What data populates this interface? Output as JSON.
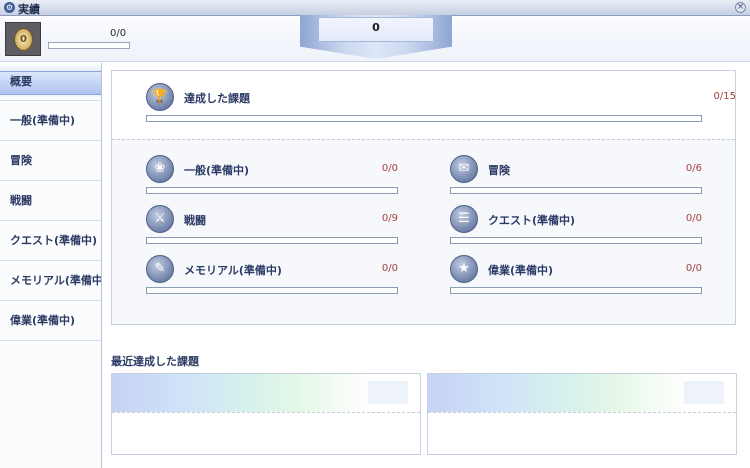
{
  "window": {
    "title": "実績",
    "title_icon": "gear-icon",
    "close_icon": "close-icon",
    "close_glyph": "×"
  },
  "header": {
    "medal_value": "0",
    "progress_text": "0/0",
    "banner_value": "0"
  },
  "sidebar": {
    "items": [
      {
        "label": "概要",
        "active": true
      },
      {
        "label": "一般(準備中)"
      },
      {
        "label": "冒険"
      },
      {
        "label": "戦闘"
      },
      {
        "label": "クエスト(準備中)"
      },
      {
        "label": "メモリアル(準備中)"
      },
      {
        "label": "偉業(準備中)"
      }
    ]
  },
  "summary": {
    "label": "達成した課題",
    "count": "0/15",
    "icon": "trophy-icon",
    "progress": 0
  },
  "categories": [
    {
      "label": "一般(準備中)",
      "count": "0/0",
      "icon": "laurel-icon",
      "progress": 0
    },
    {
      "label": "冒険",
      "count": "0/6",
      "icon": "scroll-icon",
      "progress": 0
    },
    {
      "label": "戦闘",
      "count": "0/9",
      "icon": "sword-icon",
      "progress": 0
    },
    {
      "label": "クエスト(準備中)",
      "count": "0/0",
      "icon": "quest-book-icon",
      "progress": 0
    },
    {
      "label": "メモリアル(準備中)",
      "count": "0/0",
      "icon": "quill-icon",
      "progress": 0
    },
    {
      "label": "偉業(準備中)",
      "count": "0/0",
      "icon": "star-medal-icon",
      "progress": 0
    }
  ],
  "recent": {
    "title": "最近達成した課題",
    "cards": 2
  }
}
